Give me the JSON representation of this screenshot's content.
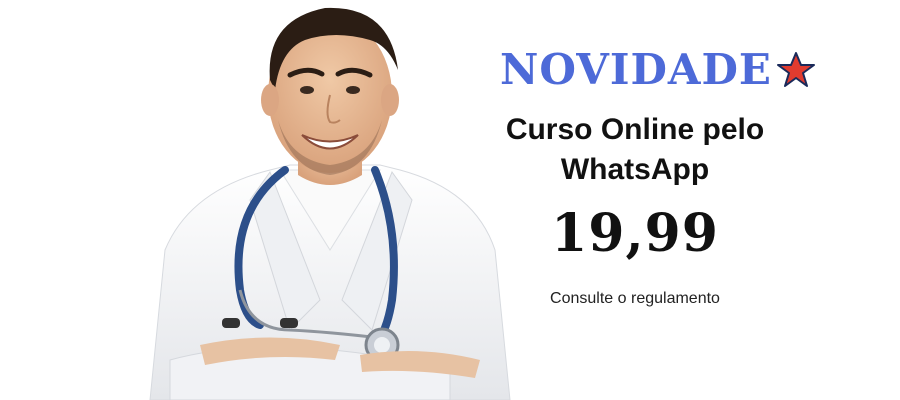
{
  "banner": {
    "headline": "NOVIDADE",
    "headline_color": "#4d6ad8",
    "star_icon": "star-icon",
    "star_color": "#e03b2f",
    "course_line1": "Curso Online pelo",
    "course_line2": "WhatsApp",
    "price": "19,99",
    "terms": "Consulte o regulamento"
  },
  "photo": {
    "subject_icon": "doctor-photo",
    "coat_color": "#f4f5f7",
    "stethoscope_color": "#2c4f8a"
  }
}
